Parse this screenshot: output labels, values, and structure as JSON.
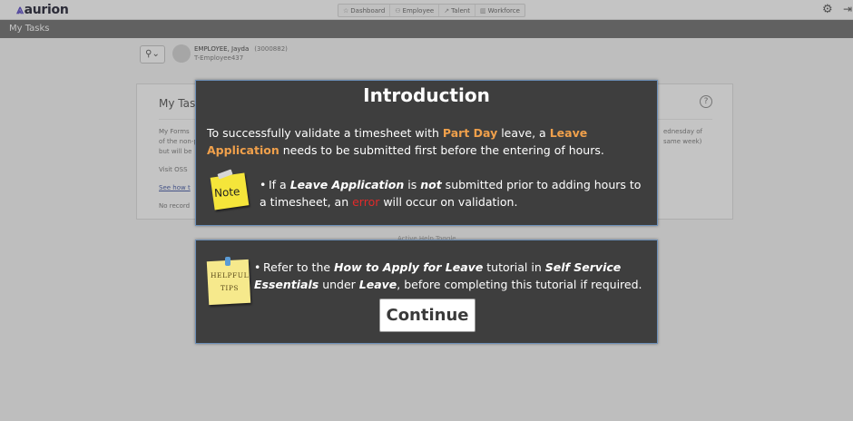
{
  "app": {
    "logo": "aurion",
    "nav": [
      {
        "label": "Dashboard",
        "icon": "star-icon"
      },
      {
        "label": "Employee",
        "icon": "people-icon"
      },
      {
        "label": "Talent",
        "icon": "arrow-icon"
      },
      {
        "label": "Workforce",
        "icon": "bars-icon"
      }
    ],
    "page_title": "My Tasks"
  },
  "user": {
    "name": "EMPLOYEE, Jayda",
    "id": "(3000882)",
    "subtitle": "T-Employee437"
  },
  "panel": {
    "title": "My Tas",
    "line1": "My Forms",
    "line2": "of the non-p",
    "line3": "but will be",
    "line4": "Visit OSS",
    "link": "See how t",
    "empty": "No record",
    "right1": "ednesday of",
    "right2": "same week)"
  },
  "faint_link": "Active Help Toggle",
  "intro": {
    "title": "Introduction",
    "p_a": "To successfully validate a timesheet with ",
    "p_hl1": "Part Day",
    "p_b": " leave, a ",
    "p_hl2": "Leave Application",
    "p_c": " needs to be submitted first before the entering of hours.",
    "note_label": "Note",
    "b_a": "If a ",
    "b_bi1": "Leave Application",
    "b_b": " is ",
    "b_bi2": "not",
    "b_c": " submitted prior to adding hours to a timesheet, an ",
    "b_err": "error",
    "b_d": " will occur on validation."
  },
  "tips": {
    "label_line1": "HELPFUL",
    "label_line2": "TIPS",
    "t_a": "Refer to the ",
    "t_bi1": "How to Apply for Leave",
    "t_b": " tutorial in ",
    "t_bi2": "Self Service Essentials",
    "t_c": " under ",
    "t_bi3": "Leave",
    "t_d": ", before completing this tutorial if required.",
    "continue_label": "Continue"
  },
  "colors": {
    "highlight": "#f0a04b",
    "error": "#e02a2a",
    "dialog_bg": "#3e3e3e"
  }
}
